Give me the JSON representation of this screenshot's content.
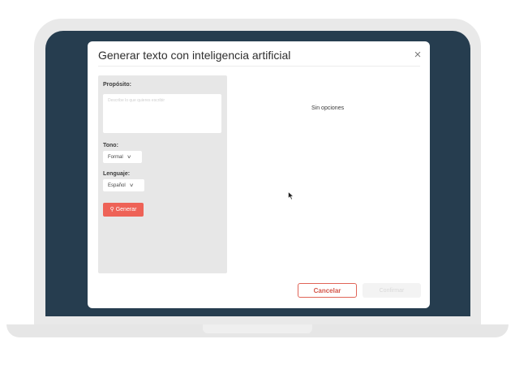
{
  "modal": {
    "title": "Generar texto con inteligencia artificial",
    "close_glyph": "×"
  },
  "form": {
    "purpose_label": "Propósito:",
    "purpose_placeholder": "Describe lo que quieres escribir",
    "purpose_value": "",
    "tone_label": "Tono:",
    "tone_value": "Formal",
    "language_label": "Lenguaje:",
    "language_value": "Español",
    "generate_label": "Generar",
    "generate_icon": "magic-wand-icon"
  },
  "results": {
    "empty_text": "Sin opciones"
  },
  "footer": {
    "cancel_label": "Cancelar",
    "confirm_label": "Confirmar",
    "confirm_enabled": false
  },
  "colors": {
    "accent": "#ee6257",
    "screen_bg": "#263d4f",
    "panel_bg": "#e7e7e7"
  }
}
